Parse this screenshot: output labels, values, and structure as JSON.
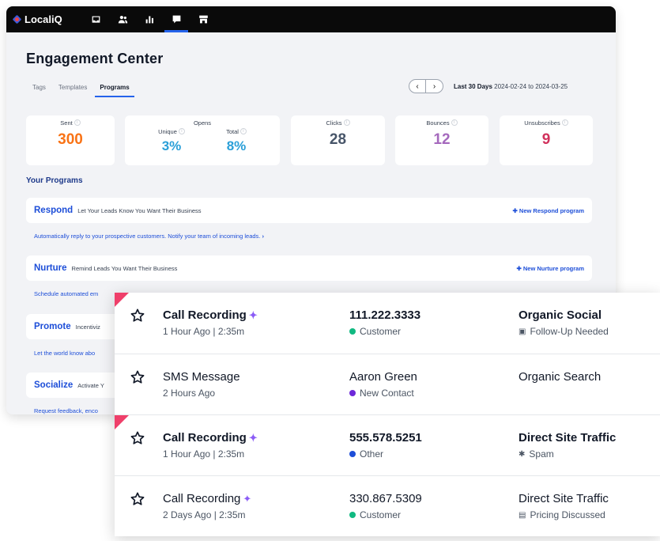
{
  "app": {
    "name": "LocaliQ"
  },
  "nav_icons": [
    "inbox-icon",
    "contacts-icon",
    "reports-icon",
    "engagement-icon",
    "store-icon"
  ],
  "page": {
    "title": "Engagement Center"
  },
  "tabs": [
    {
      "label": "Tags"
    },
    {
      "label": "Templates"
    },
    {
      "label": "Programs"
    }
  ],
  "date_nav": {
    "prev": "‹",
    "next": "›",
    "range_label": "Last 30 Days",
    "range_dates": "2024-02-24 to 2024-03-25"
  },
  "stats": {
    "sent": {
      "label": "Sent",
      "value": "300",
      "color": "#f97316"
    },
    "opens": {
      "label": "Opens",
      "unique_label": "Unique",
      "unique_value": "3%",
      "total_label": "Total",
      "total_value": "8%",
      "color": "#2a9fd8"
    },
    "clicks": {
      "label": "Clicks",
      "value": "28",
      "color": "#475569"
    },
    "bounces": {
      "label": "Bounces",
      "value": "12",
      "color": "#a569bd"
    },
    "unsubscribes": {
      "label": "Unsubscribes",
      "value": "9",
      "color": "#d1315c"
    }
  },
  "programs_title": "Your Programs",
  "programs": [
    {
      "name": "Respond",
      "tagline": "Let Your Leads Know You Want Their Business",
      "new_label": "New Respond program",
      "description": "Automatically reply to your prospective customers. Notify your team of incoming leads."
    },
    {
      "name": "Nurture",
      "tagline": "Remind Leads You Want Their Business",
      "new_label": "New Nurture program",
      "description": "Schedule automated em"
    },
    {
      "name": "Promote",
      "tagline": "Incentiviz",
      "description": "Let the world know abo"
    },
    {
      "name": "Socialize",
      "tagline": "Activate Y",
      "description": "Request feedback, enco"
    }
  ],
  "calls": [
    {
      "title": "Call Recording",
      "sparkle": true,
      "bold": true,
      "time": "1 Hour Ago | 2:35m",
      "contact": "111.222.3333",
      "contact_type": "Customer",
      "dot_color": "#10b981",
      "source": "Organic Social",
      "source_tag": "Follow-Up Needed",
      "tag_icon": "chat-flag-icon",
      "tag_glyph": "▣",
      "flag": true
    },
    {
      "title": "SMS Message",
      "sparkle": false,
      "bold": false,
      "time": "2 Hours Ago",
      "contact": "Aaron Green",
      "contact_type": "New Contact",
      "dot_color": "#6d28d9",
      "source": "Organic Search",
      "source_tag": "",
      "tag_icon": "",
      "tag_glyph": "",
      "flag": false
    },
    {
      "title": "Call Recording",
      "sparkle": true,
      "bold": true,
      "time": "1 Hour Ago | 2:35m",
      "contact": "555.578.5251",
      "contact_type": "Other",
      "dot_color": "#1d4ed8",
      "source": "Direct Site Traffic",
      "source_tag": "Spam",
      "tag_icon": "spam-bug-icon",
      "tag_glyph": "✱",
      "flag": true
    },
    {
      "title": "Call Recording",
      "sparkle": true,
      "bold": false,
      "time": "2 Days Ago | 2:35m",
      "contact": "330.867.5309",
      "contact_type": "Customer",
      "dot_color": "#10b981",
      "source": "Direct Site Traffic",
      "source_tag": "Pricing Discussed",
      "tag_icon": "document-icon",
      "tag_glyph": "▤",
      "flag": false
    }
  ]
}
